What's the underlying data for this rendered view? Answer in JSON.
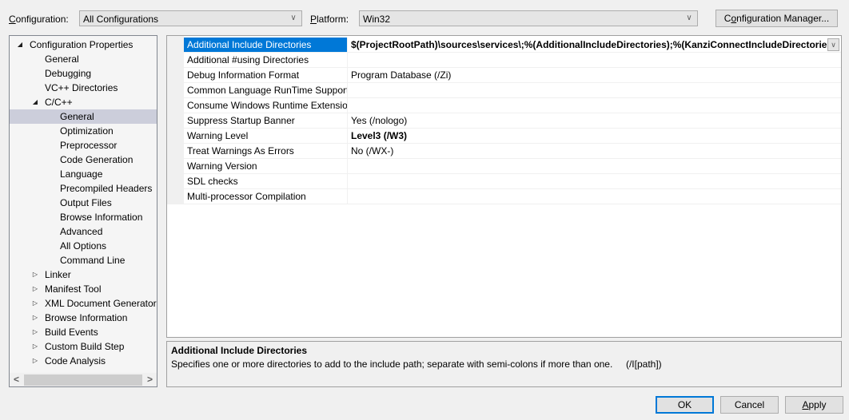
{
  "topbar": {
    "configuration_label": "Configuration:",
    "configuration_value": "All Configurations",
    "platform_label": "Platform:",
    "platform_value": "Win32",
    "config_manager_label": "Configuration Manager..."
  },
  "tree": {
    "items": [
      {
        "label": "Configuration Properties",
        "expander": "expanded",
        "level": 0
      },
      {
        "label": "General",
        "level": 1
      },
      {
        "label": "Debugging",
        "level": 1
      },
      {
        "label": "VC++ Directories",
        "level": 1
      },
      {
        "label": "C/C++",
        "expander": "expanded",
        "level": 1
      },
      {
        "label": "General",
        "level": 2,
        "selected": true
      },
      {
        "label": "Optimization",
        "level": 2
      },
      {
        "label": "Preprocessor",
        "level": 2
      },
      {
        "label": "Code Generation",
        "level": 2
      },
      {
        "label": "Language",
        "level": 2
      },
      {
        "label": "Precompiled Headers",
        "level": 2
      },
      {
        "label": "Output Files",
        "level": 2
      },
      {
        "label": "Browse Information",
        "level": 2
      },
      {
        "label": "Advanced",
        "level": 2
      },
      {
        "label": "All Options",
        "level": 2
      },
      {
        "label": "Command Line",
        "level": 2
      },
      {
        "label": "Linker",
        "expander": "collapsed",
        "level": 1
      },
      {
        "label": "Manifest Tool",
        "expander": "collapsed",
        "level": 1
      },
      {
        "label": "XML Document Generator",
        "expander": "collapsed",
        "level": 1
      },
      {
        "label": "Browse Information",
        "expander": "collapsed",
        "level": 1
      },
      {
        "label": "Build Events",
        "expander": "collapsed",
        "level": 1
      },
      {
        "label": "Custom Build Step",
        "expander": "collapsed",
        "level": 1
      },
      {
        "label": "Code Analysis",
        "expander": "collapsed",
        "level": 1
      }
    ],
    "scroll_left_glyph": "<",
    "scroll_right_glyph": ">"
  },
  "properties": [
    {
      "name": "Additional Include Directories",
      "value": "$(ProjectRootPath)\\sources\\services\\;%(AdditionalIncludeDirectories);%(KanziConnectIncludeDirectories)",
      "bold": true,
      "selected": true
    },
    {
      "name": "Additional #using Directories",
      "value": ""
    },
    {
      "name": "Debug Information Format",
      "value": "Program Database (/Zi)"
    },
    {
      "name": "Common Language RunTime Support",
      "value": ""
    },
    {
      "name": "Consume Windows Runtime Extension",
      "value": ""
    },
    {
      "name": "Suppress Startup Banner",
      "value": "Yes (/nologo)"
    },
    {
      "name": "Warning Level",
      "value": "Level3 (/W3)",
      "bold": true
    },
    {
      "name": "Treat Warnings As Errors",
      "value": "No (/WX-)"
    },
    {
      "name": "Warning Version",
      "value": ""
    },
    {
      "name": "SDL checks",
      "value": ""
    },
    {
      "name": "Multi-processor Compilation",
      "value": ""
    }
  ],
  "description": {
    "title": "Additional Include Directories",
    "text": "Specifies one or more directories to add to the include path; separate with semi-colons if more than one.     (/I[path])"
  },
  "buttons": {
    "ok": "OK",
    "cancel": "Cancel",
    "apply": "Apply"
  },
  "colors": {
    "selection_accent": "#0078d7",
    "tree_selection": "#cccedb"
  }
}
